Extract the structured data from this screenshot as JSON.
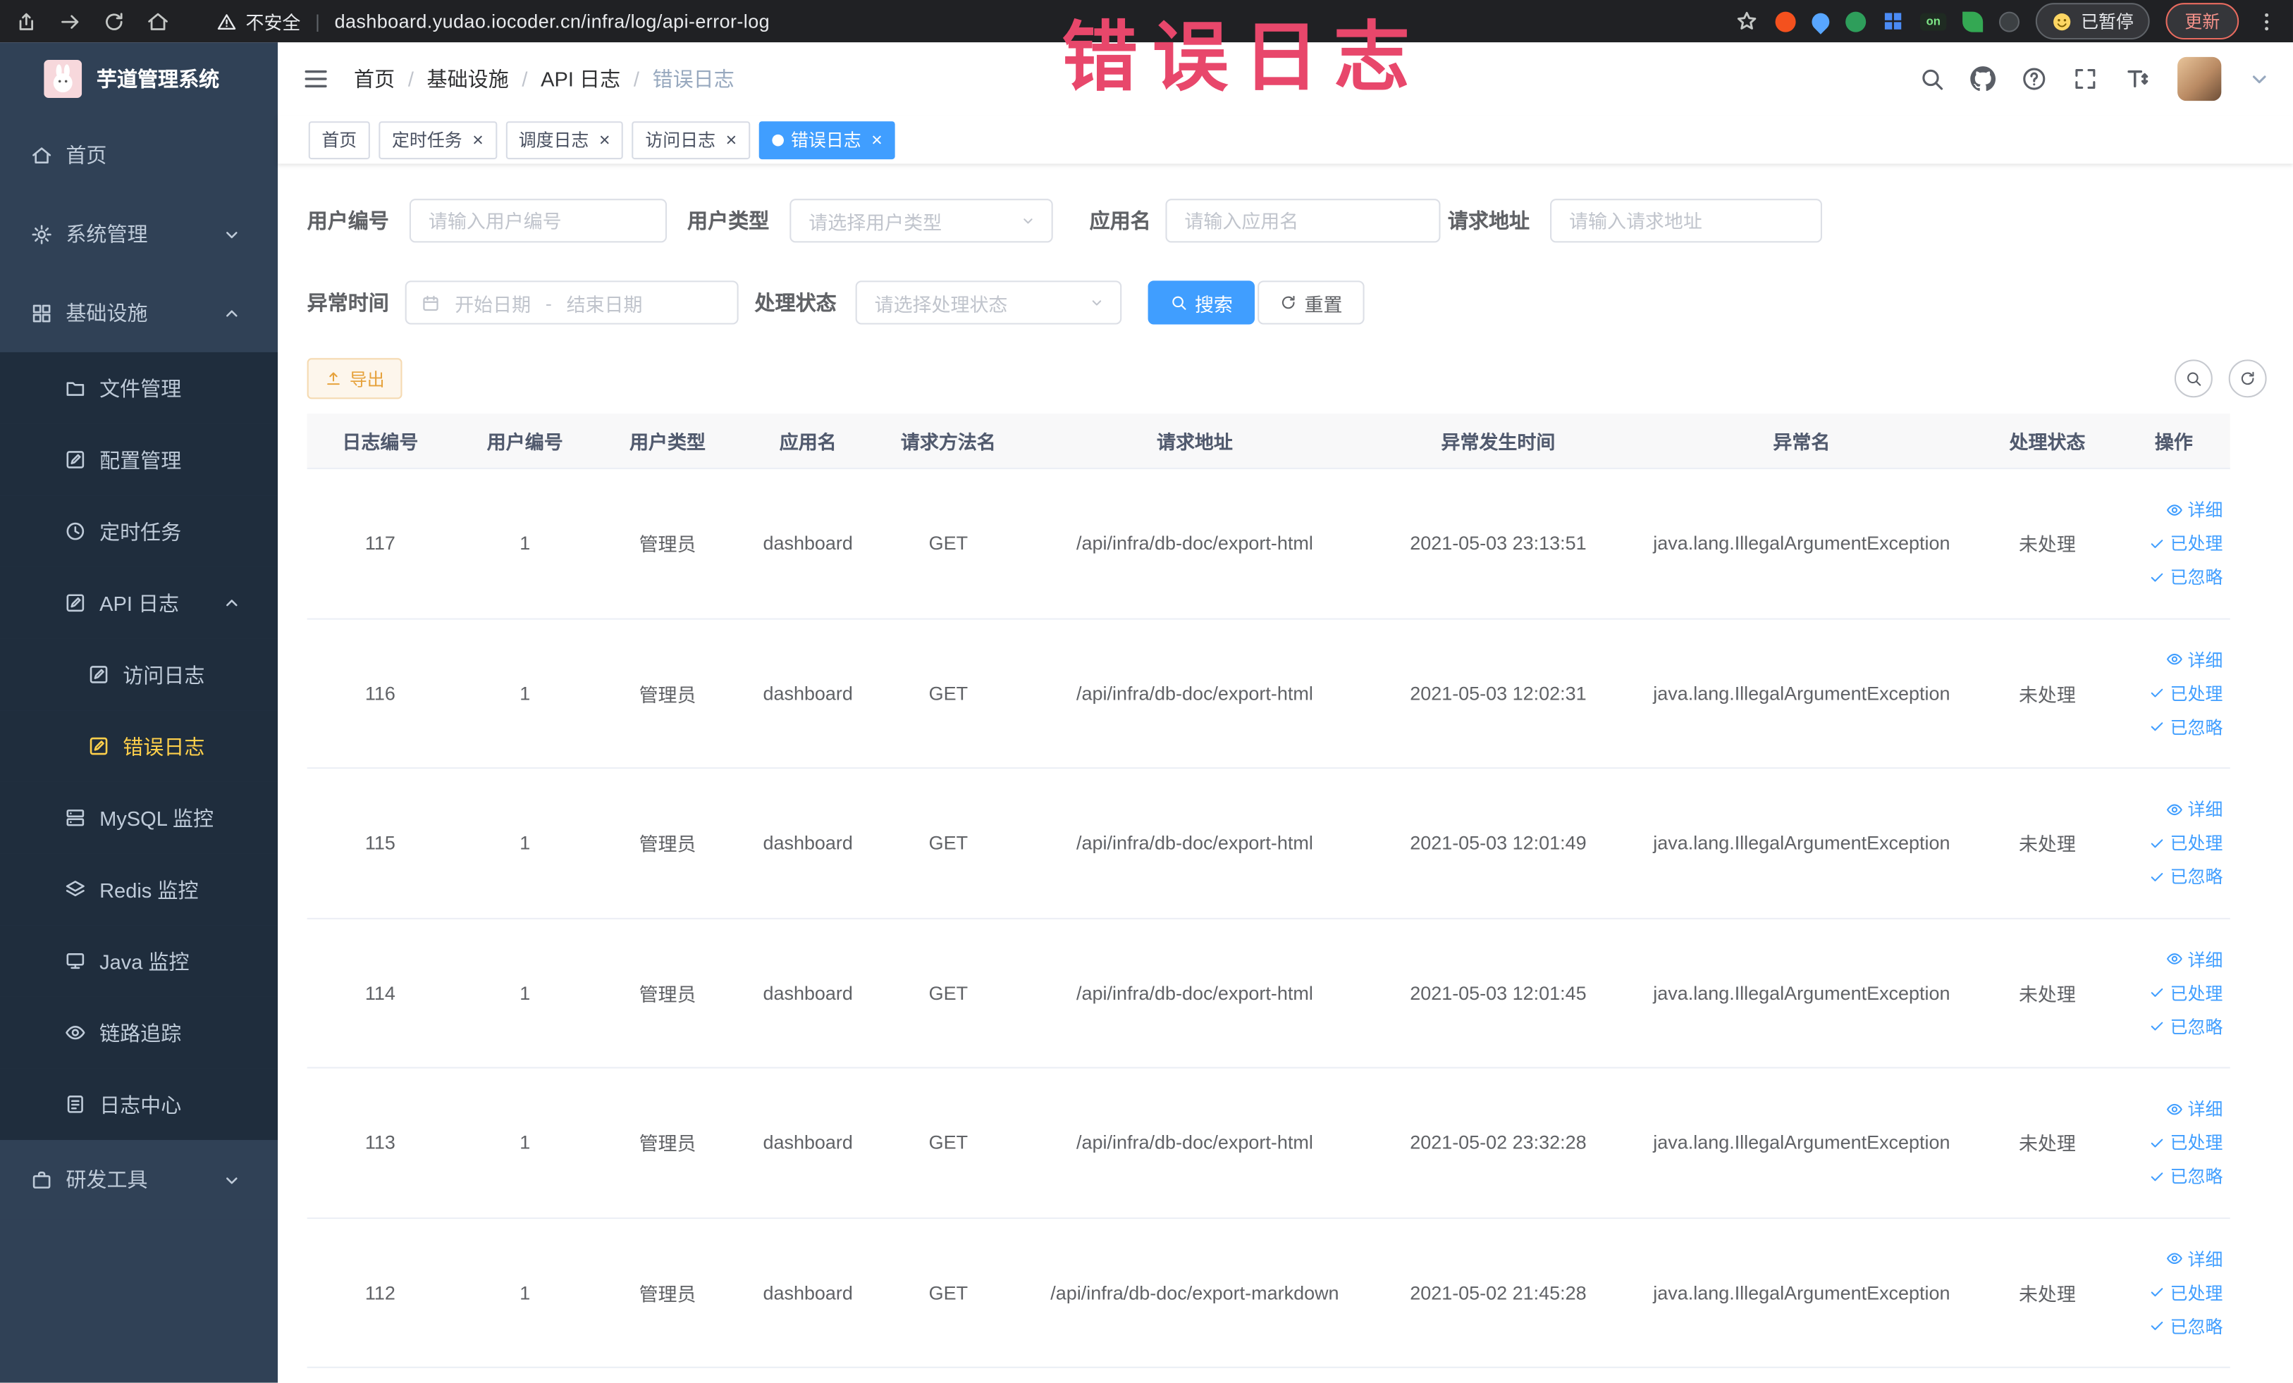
{
  "browser": {
    "security_label": "不安全",
    "url": "dashboard.yudao.iocoder.cn/infra/log/api-error-log",
    "paused_label": "已暂停",
    "update_label": "更新",
    "on_badge": "on"
  },
  "annotation": {
    "text": "错误日志",
    "color": "#e8476b"
  },
  "sidebar": {
    "logo_title": "芋道管理系统",
    "items": [
      {
        "key": "home",
        "label": "首页",
        "icon": "home",
        "level": "top"
      },
      {
        "key": "system",
        "label": "系统管理",
        "icon": "gear",
        "level": "top",
        "chevron": "down"
      },
      {
        "key": "infra",
        "label": "基础设施",
        "icon": "grid",
        "level": "top",
        "chevron": "up"
      },
      {
        "key": "file",
        "label": "文件管理",
        "icon": "folder",
        "level": "sub"
      },
      {
        "key": "config",
        "label": "配置管理",
        "icon": "edit",
        "level": "sub"
      },
      {
        "key": "job",
        "label": "定时任务",
        "icon": "clock",
        "level": "sub"
      },
      {
        "key": "api-log",
        "label": "API 日志",
        "icon": "edit",
        "level": "sub",
        "chevron": "up"
      },
      {
        "key": "access-log",
        "label": "访问日志",
        "icon": "edit",
        "level": "sub2"
      },
      {
        "key": "error-log",
        "label": "错误日志",
        "icon": "edit",
        "level": "sub2",
        "active": true
      },
      {
        "key": "mysql",
        "label": "MySQL 监控",
        "icon": "server",
        "level": "sub"
      },
      {
        "key": "redis",
        "label": "Redis 监控",
        "icon": "layers",
        "level": "sub"
      },
      {
        "key": "java",
        "label": "Java 监控",
        "icon": "monitor",
        "level": "sub"
      },
      {
        "key": "trace",
        "label": "链路追踪",
        "icon": "eye",
        "level": "sub"
      },
      {
        "key": "log-center",
        "label": "日志中心",
        "icon": "note",
        "level": "sub"
      },
      {
        "key": "dev-tools",
        "label": "研发工具",
        "icon": "case",
        "level": "top",
        "chevron": "down"
      }
    ]
  },
  "header": {
    "breadcrumb": [
      "首页",
      "基础设施",
      "API 日志",
      "错误日志"
    ]
  },
  "tabs": [
    {
      "key": "home",
      "label": "首页",
      "closable": false,
      "active": false
    },
    {
      "key": "job",
      "label": "定时任务",
      "closable": true,
      "active": false
    },
    {
      "key": "job-log",
      "label": "调度日志",
      "closable": true,
      "active": false
    },
    {
      "key": "access-log",
      "label": "访问日志",
      "closable": true,
      "active": false
    },
    {
      "key": "error-log",
      "label": "错误日志",
      "closable": true,
      "active": true
    }
  ],
  "filters": {
    "user_id": {
      "label": "用户编号",
      "placeholder": "请输入用户编号"
    },
    "user_type": {
      "label": "用户类型",
      "placeholder": "请选择用户类型"
    },
    "app_name": {
      "label": "应用名",
      "placeholder": "请输入应用名"
    },
    "request_url": {
      "label": "请求地址",
      "placeholder": "请输入请求地址"
    },
    "exception_time": {
      "label": "异常时间",
      "start_placeholder": "开始日期",
      "separator": "-",
      "end_placeholder": "结束日期"
    },
    "process_status": {
      "label": "处理状态",
      "placeholder": "请选择处理状态"
    },
    "search_label": "搜索",
    "reset_label": "重置"
  },
  "toolbar": {
    "export_label": "导出"
  },
  "table": {
    "columns": [
      "日志编号",
      "用户编号",
      "用户类型",
      "应用名",
      "请求方法名",
      "请求地址",
      "异常发生时间",
      "异常名",
      "处理状态",
      "操作"
    ],
    "rows": [
      {
        "log_id": "117",
        "user_id": "1",
        "user_type": "管理员",
        "app_name": "dashboard",
        "method": "GET",
        "url": "/api/infra/db-doc/export-html",
        "time": "2021-05-03 23:13:51",
        "exception": "java.lang.IllegalArgumentException",
        "status": "未处理"
      },
      {
        "log_id": "116",
        "user_id": "1",
        "user_type": "管理员",
        "app_name": "dashboard",
        "method": "GET",
        "url": "/api/infra/db-doc/export-html",
        "time": "2021-05-03 12:02:31",
        "exception": "java.lang.IllegalArgumentException",
        "status": "未处理"
      },
      {
        "log_id": "115",
        "user_id": "1",
        "user_type": "管理员",
        "app_name": "dashboard",
        "method": "GET",
        "url": "/api/infra/db-doc/export-html",
        "time": "2021-05-03 12:01:49",
        "exception": "java.lang.IllegalArgumentException",
        "status": "未处理"
      },
      {
        "log_id": "114",
        "user_id": "1",
        "user_type": "管理员",
        "app_name": "dashboard",
        "method": "GET",
        "url": "/api/infra/db-doc/export-html",
        "time": "2021-05-03 12:01:45",
        "exception": "java.lang.IllegalArgumentException",
        "status": "未处理"
      },
      {
        "log_id": "113",
        "user_id": "1",
        "user_type": "管理员",
        "app_name": "dashboard",
        "method": "GET",
        "url": "/api/infra/db-doc/export-html",
        "time": "2021-05-02 23:32:28",
        "exception": "java.lang.IllegalArgumentException",
        "status": "未处理"
      },
      {
        "log_id": "112",
        "user_id": "1",
        "user_type": "管理员",
        "app_name": "dashboard",
        "method": "GET",
        "url": "/api/infra/db-doc/export-markdown",
        "time": "2021-05-02 21:45:28",
        "exception": "java.lang.IllegalArgumentException",
        "status": "未处理"
      }
    ],
    "actions": {
      "detail": "详细",
      "processed": "已处理",
      "ignored": "已忽略"
    }
  },
  "icons": {
    "breadcrumb_separator": "/",
    "tab_close": "×",
    "date_separator": "-"
  },
  "colors": {
    "accent": "#409eff",
    "sidebar": "#304156",
    "submenu": "#1f2d3d",
    "active_menu": "#ffd04b",
    "warning": "#e6a23c",
    "annotation": "#e8476b",
    "header_text": "#515a6e"
  }
}
